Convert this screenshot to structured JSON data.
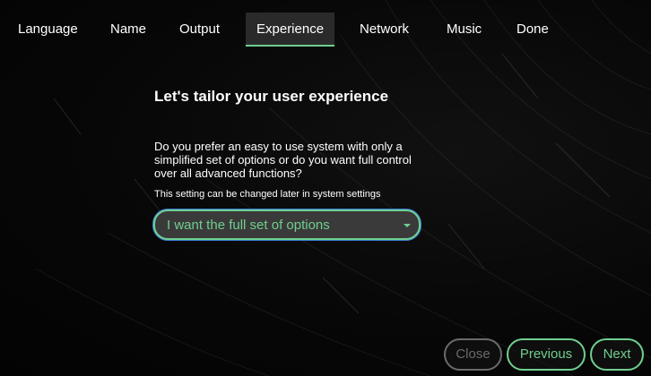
{
  "tabs": [
    {
      "label": "Language"
    },
    {
      "label": "Name"
    },
    {
      "label": "Output"
    },
    {
      "label": "Experience",
      "active": true
    },
    {
      "label": "Network"
    },
    {
      "label": "Music"
    },
    {
      "label": "Done"
    }
  ],
  "main": {
    "heading": "Let's tailor your user experience",
    "question": "Do you prefer an easy to use system with only a simplified set of options or do you want full control over all advanced functions?",
    "note": "This setting can be changed later in system settings",
    "select": {
      "value": "I want the full set of options"
    }
  },
  "footer": {
    "close_label": "Close",
    "previous_label": "Previous",
    "next_label": "Next"
  },
  "colors": {
    "accent": "#6fcf8f",
    "active_tab_bg": "#2a2a2a",
    "disabled": "#6a6a6a",
    "focus_ring": "#3b7dd8"
  },
  "icons": {
    "select_caret": "caret-down-icon"
  }
}
